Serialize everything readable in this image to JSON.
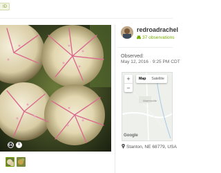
{
  "header": {
    "id_badge": "ID"
  },
  "photo": {
    "license_icon": "cc-icon",
    "license_text": "cc",
    "info_icon": "info-icon",
    "info_text": "i",
    "thumbnails_count": 2
  },
  "observer": {
    "username": "redroadrachel",
    "observations": "37 observations",
    "observations_icon": "binoculars-icon",
    "accent": "#74ac00"
  },
  "observed": {
    "label": "Observed:",
    "date": "May 12, 2016 · 9:25 PM CDT"
  },
  "map": {
    "zoom_in": "+",
    "zoom_out": "−",
    "type_map": "Map",
    "type_satellite": "Satellite",
    "town_label": "Warrenville",
    "attribution": "Google"
  },
  "location": {
    "text": "Stanton, NE 68779, USA",
    "icon": "map-pin-icon"
  }
}
